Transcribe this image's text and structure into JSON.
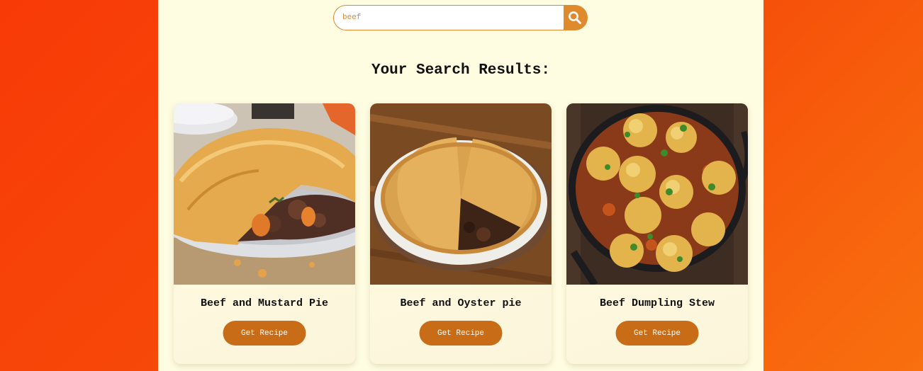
{
  "search": {
    "value": "beef",
    "placeholder": "",
    "button_icon": "search-icon"
  },
  "results": {
    "title": "Your Search Results:"
  },
  "recipes": [
    {
      "name": "Beef and Mustard Pie",
      "button_label": "Get Recipe",
      "image": "beef-and-mustard-pie-photo"
    },
    {
      "name": "Beef and Oyster pie",
      "button_label": "Get Recipe",
      "image": "beef-and-oyster-pie-photo"
    },
    {
      "name": "Beef Dumpling Stew",
      "button_label": "Get Recipe",
      "image": "beef-dumpling-stew-photo"
    }
  ],
  "colors": {
    "page_background": "#f64d09",
    "container_background": "#fefce1",
    "search_accent": "#e08a2e",
    "button_background": "#c86c18"
  }
}
